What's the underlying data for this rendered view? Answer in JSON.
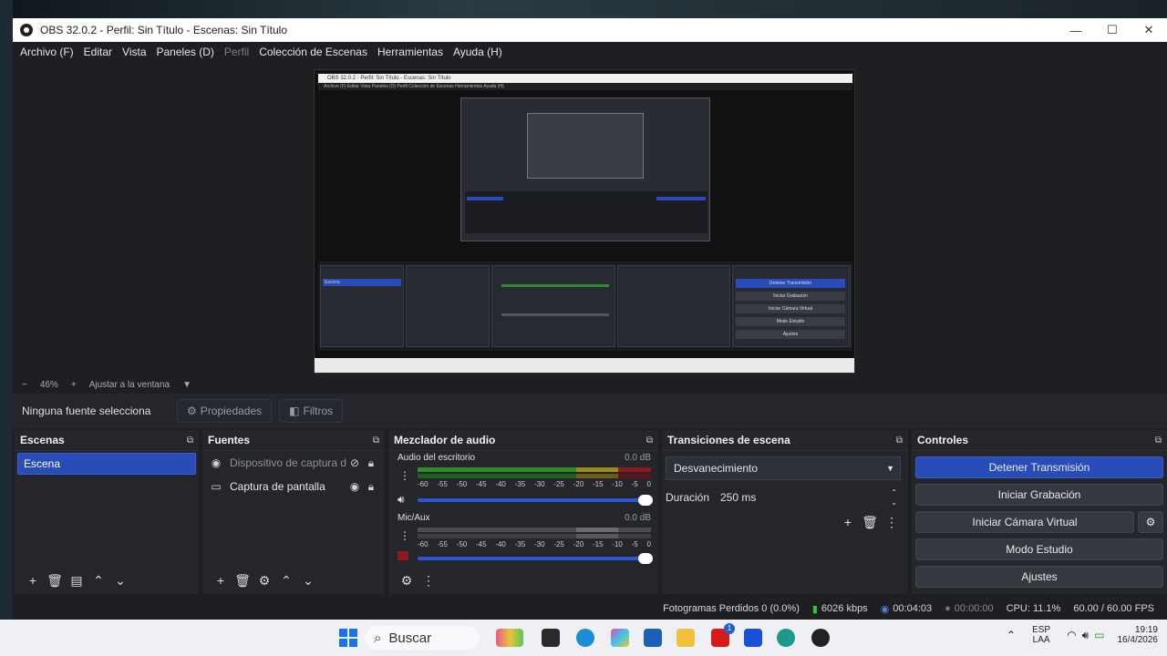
{
  "window": {
    "title": "OBS 32.0.2 - Perfil: Sin Título - Escenas: Sin Título",
    "minimize": "—",
    "maximize": "☐",
    "close": "✕"
  },
  "menu": {
    "items": [
      "Archivo (F)",
      "Editar",
      "Vista",
      "Paneles (D)",
      "Perfil",
      "Colección de Escenas",
      "Herramientas",
      "Ayuda (H)"
    ]
  },
  "preview": {
    "title": "OBS 32.0.2 - Perfil: Sin Título - Escenas: Sin Título",
    "menu": "Archivo (F)   Editar   Vista   Paneles (D)   Perfil   Colección de Escenas   Herramientas   Ayuda (H)",
    "no_source": "Ninguna fuente selecciona",
    "scene": "Escena",
    "btn_stop": "Detener Transmisión",
    "btn_rec": "Iniciar Grabación",
    "btn_vcam": "Iniciar Cámara Virtual",
    "btn_studio": "Modo Estudio",
    "btn_settings": "Ajustes"
  },
  "zoom": {
    "minus": "−",
    "value": "46%",
    "plus": "+",
    "fit": "Ajustar a la ventana",
    "arrow": "▼"
  },
  "toolbar": {
    "no_source": "Ninguna fuente selecciona",
    "properties": "Propiedades",
    "filters": "Filtros"
  },
  "scenes": {
    "title": "Escenas",
    "items": [
      "Escena"
    ]
  },
  "sources": {
    "title": "Fuentes",
    "items": [
      "Dispositivo de captura de",
      "Captura de pantalla"
    ]
  },
  "mixer": {
    "title": "Mezclador de audio",
    "channels": [
      {
        "name": "Audio del escritorio",
        "db": "0.0 dB",
        "level": 0.62
      },
      {
        "name": "Mic/Aux",
        "db": "0.0 dB",
        "level": 0.0
      }
    ],
    "ticks": [
      "-60",
      "-55",
      "-50",
      "-45",
      "-40",
      "-35",
      "-30",
      "-25",
      "-20",
      "-15",
      "-10",
      "-5",
      "0"
    ]
  },
  "transitions": {
    "title": "Transiciones de escena",
    "selected": "Desvanecimiento",
    "duration_label": "Duración",
    "duration_value": "250 ms"
  },
  "controls": {
    "title": "Controles",
    "stop_stream": "Detener Transmisión",
    "start_recording": "Iniciar Grabación",
    "start_vcam": "Iniciar Cámara Virtual",
    "studio_mode": "Modo Estudio",
    "settings": "Ajustes"
  },
  "status": {
    "dropped": "Fotogramas Perdidos 0 (0.0%)",
    "bitrate": "6026 kbps",
    "stream_time": "00:04:03",
    "rec_time": "00:00:00",
    "cpu": "CPU: 11.1%",
    "fps": "60.00 / 60.00 FPS"
  },
  "taskbar": {
    "search": "Buscar",
    "lang1": "ESP",
    "lang2": "LAA",
    "time": "19:19",
    "date": "16/4/2026",
    "badge": "1"
  },
  "colors": {
    "accent": "#284cb8",
    "meter_green": "#2e8b2e",
    "meter_yellow": "#9a8a20",
    "meter_red": "#8a1a20"
  }
}
